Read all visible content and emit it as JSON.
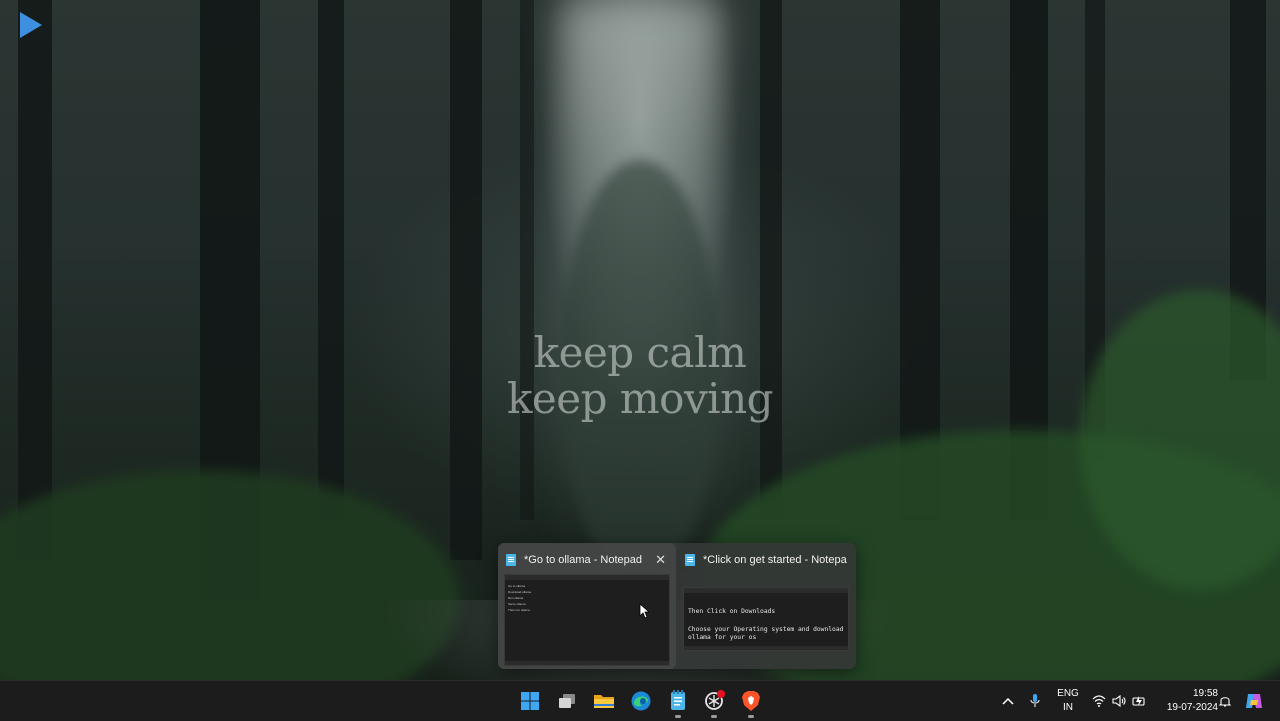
{
  "desktop": {
    "quote_line1": "keep calm",
    "quote_line2": "keep moving"
  },
  "preview_popup": {
    "windows": [
      {
        "title": "*Go to ollama - Notepad",
        "close_label": "✕",
        "thumb_lines": [
          "Go to ollama",
          "Download ollama",
          "Run ollama",
          "Serve ollama",
          "Then run ollama"
        ]
      },
      {
        "title": "*Click on get started - Notepad",
        "thumb_lines": [
          "Then Click on Downloads",
          "",
          "Choose your Operating system and download",
          "ollama for your os"
        ]
      }
    ]
  },
  "taskbar": {
    "apps": [
      {
        "name": "start-button",
        "icon": "windows-icon"
      },
      {
        "name": "task-view-button",
        "icon": "task-view-icon"
      },
      {
        "name": "file-explorer-button",
        "icon": "folder-icon"
      },
      {
        "name": "edge-button",
        "icon": "edge-icon"
      },
      {
        "name": "notepad-button",
        "icon": "notepad-icon"
      },
      {
        "name": "chatgpt-button",
        "icon": "openai-icon"
      },
      {
        "name": "brave-button",
        "icon": "brave-icon"
      }
    ],
    "tray": {
      "language_line1": "ENG",
      "language_line2": "IN",
      "time": "19:58",
      "date": "19-07-2024"
    }
  },
  "colors": {
    "taskbar_bg": "#1c1c1c",
    "accent_blue": "#3f8fe0",
    "notepad_blue": "#4cb6e8",
    "brave_orange": "#fb542b"
  }
}
